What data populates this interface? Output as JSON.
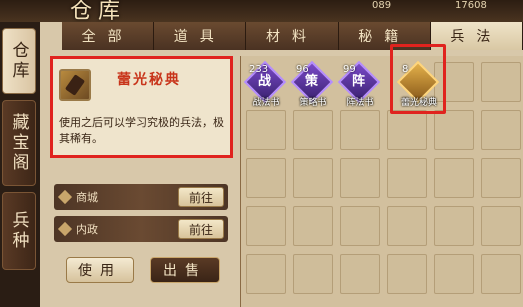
{
  "title": "仓库",
  "currency": [
    "089",
    "17608"
  ],
  "side_tabs": [
    {
      "label": "仓库",
      "active": true
    },
    {
      "label": "藏宝阁",
      "active": false
    },
    {
      "label": "兵种",
      "active": false
    }
  ],
  "top_tabs": [
    {
      "label": "全部",
      "active": false
    },
    {
      "label": "道具",
      "active": false
    },
    {
      "label": "材料",
      "active": false
    },
    {
      "label": "秘籍",
      "active": false
    },
    {
      "label": "兵法",
      "active": true
    }
  ],
  "selected_item": {
    "name": "蕾光秘典",
    "description": "使用之后可以学习究极的兵法，极其稀有。"
  },
  "sources": [
    {
      "label": "商城",
      "button": "前往"
    },
    {
      "label": "内政",
      "button": "前往"
    }
  ],
  "buttons": {
    "use": "使用",
    "sell": "出售"
  },
  "items": [
    {
      "count": "233",
      "glyph": "战",
      "name": "战法书",
      "rarity": "purple"
    },
    {
      "count": "96",
      "glyph": "策",
      "name": "策略书",
      "rarity": "purple"
    },
    {
      "count": "99",
      "glyph": "阵",
      "name": "阵法书",
      "rarity": "purple"
    },
    {
      "count": "8",
      "glyph": "",
      "name": "蕾光秘典",
      "rarity": "gold"
    }
  ]
}
